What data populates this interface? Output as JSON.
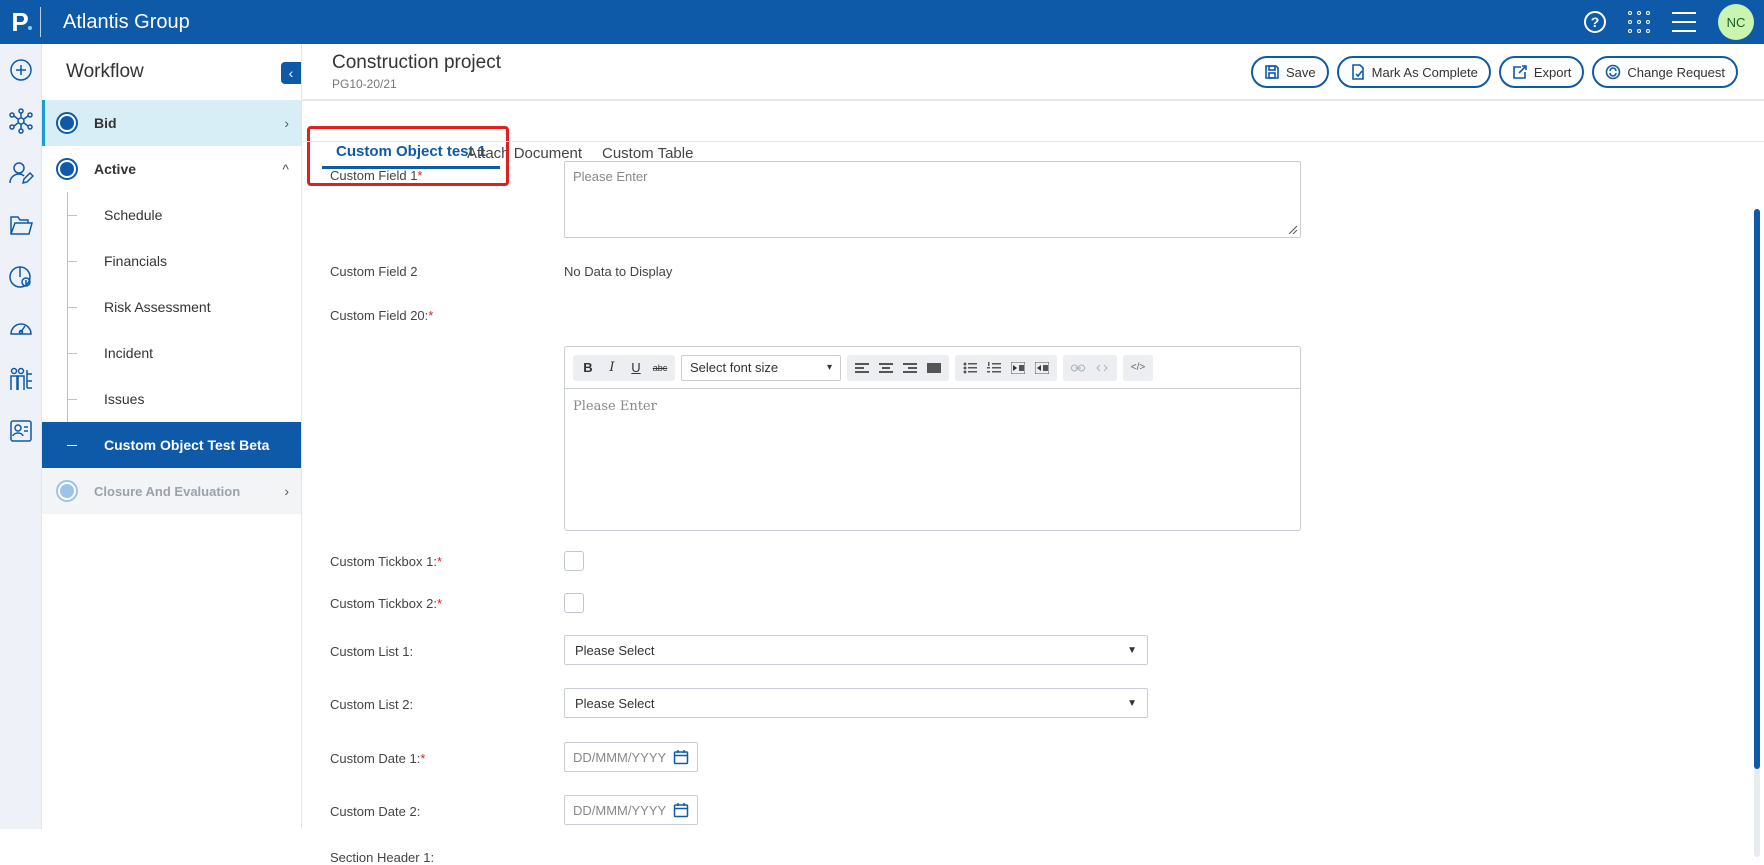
{
  "app": {
    "logo": "P",
    "title": "Atlantis Group",
    "user_initials": "NC",
    "help_glyph": "?"
  },
  "colors": {
    "brand": "#0f5aa8",
    "required": "#e02020",
    "highlight": "#e02020",
    "avatar": "#c9f5b0"
  },
  "rail_icons": [
    "plus-circle-icon",
    "network-icon",
    "user-edit-icon",
    "folders-icon",
    "budget-icon",
    "dashboard-icon",
    "people-hierarchy-icon",
    "profile-card-icon"
  ],
  "workflow": {
    "title": "Workflow",
    "collapse_glyph": "‹",
    "bid": {
      "label": "Bid",
      "chevron": "›"
    },
    "active": {
      "label": "Active",
      "chevron": "^"
    },
    "substeps": [
      "Schedule",
      "Financials",
      "Risk Assessment",
      "Incident",
      "Issues",
      "Custom Object Test Beta"
    ],
    "closure": {
      "label": "Closure And Evaluation",
      "chevron": "›"
    }
  },
  "project": {
    "title": "Construction project",
    "code": "PG10-20/21"
  },
  "actions": {
    "save": "Save",
    "complete": "Mark As Complete",
    "export": "Export",
    "change_request": "Change Request"
  },
  "tabs": [
    "Custom Object test 1",
    "Attach Document",
    "Custom Table"
  ],
  "form": {
    "field1": {
      "label": "Custom Field 1",
      "req": "*",
      "placeholder": "Please Enter"
    },
    "field2": {
      "label": "Custom Field 2",
      "value": "No Data to Display"
    },
    "field20": {
      "label": "Custom Field 20:",
      "req": "*",
      "placeholder": "Please Enter"
    },
    "toolbar": {
      "bold": "B",
      "italic": "I",
      "underline": "U",
      "strike": "abc",
      "font_size": "Select font size",
      "font_caret": "▾",
      "source": "</>"
    },
    "tick1": {
      "label": "Custom Tickbox 1:",
      "req": "*",
      "checked": false
    },
    "tick2": {
      "label": "Custom Tickbox 2:",
      "req": "*",
      "checked": false
    },
    "list1": {
      "label": "Custom List 1:",
      "value": "Please Select",
      "caret": "▼"
    },
    "list2": {
      "label": "Custom List 2:",
      "value": "Please Select",
      "caret": "▼"
    },
    "date1": {
      "label": "Custom Date 1:",
      "req": "*",
      "placeholder": "DD/MMM/YYYY"
    },
    "date2": {
      "label": "Custom Date 2:",
      "placeholder": "DD/MMM/YYYY"
    },
    "section": {
      "label": "Section Header 1:"
    }
  }
}
